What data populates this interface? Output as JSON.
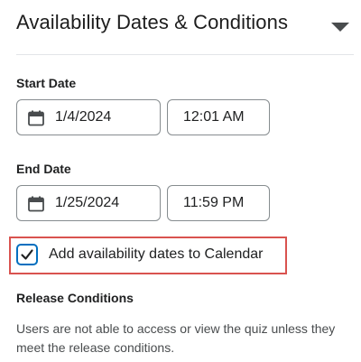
{
  "section": {
    "title": "Availability Dates & Conditions",
    "collapse_icon": "caret-down-icon"
  },
  "start": {
    "label": "Start Date",
    "date": "1/4/2024",
    "time": "12:01 AM",
    "date_icon": "calendar-icon"
  },
  "end": {
    "label": "End Date",
    "date": "1/25/2024",
    "time": "11:59 PM",
    "date_icon": "calendar-icon"
  },
  "calendar_option": {
    "label": "Add availability dates to Calendar",
    "checked": true
  },
  "release": {
    "title": "Release Conditions",
    "description": "Users are not able to access or view the quiz unless they meet the release conditions."
  },
  "colors": {
    "checkbox_accent": "#006fbf",
    "highlight": "#d9534f"
  }
}
